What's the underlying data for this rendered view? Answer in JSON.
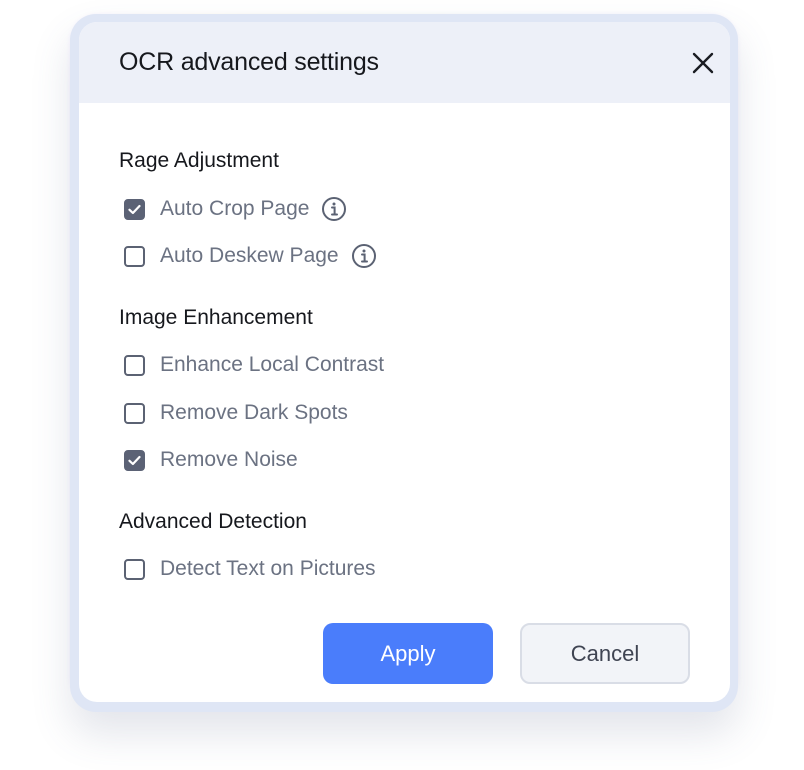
{
  "dialog": {
    "title": "OCR advanced settings",
    "close_icon": "close-icon"
  },
  "sections": [
    {
      "heading": "Rage Adjustment",
      "options": [
        {
          "label": "Auto Crop Page",
          "checked": true,
          "info": true
        },
        {
          "label": "Auto Deskew Page",
          "checked": false,
          "info": true
        }
      ]
    },
    {
      "heading": "Image Enhancement",
      "options": [
        {
          "label": "Enhance Local Contrast",
          "checked": false
        },
        {
          "label": "Remove Dark Spots",
          "checked": false
        },
        {
          "label": "Remove Noise",
          "checked": true
        }
      ]
    },
    {
      "heading": "Advanced Detection",
      "options": [
        {
          "label": "Detect Text on Pictures",
          "checked": false
        }
      ]
    }
  ],
  "buttons": {
    "apply_label": "Apply",
    "cancel_label": "Cancel"
  },
  "colors": {
    "accent": "#4a7dfb",
    "header_bg": "#edf0f8",
    "checkbox_checked": "#5b6275"
  }
}
